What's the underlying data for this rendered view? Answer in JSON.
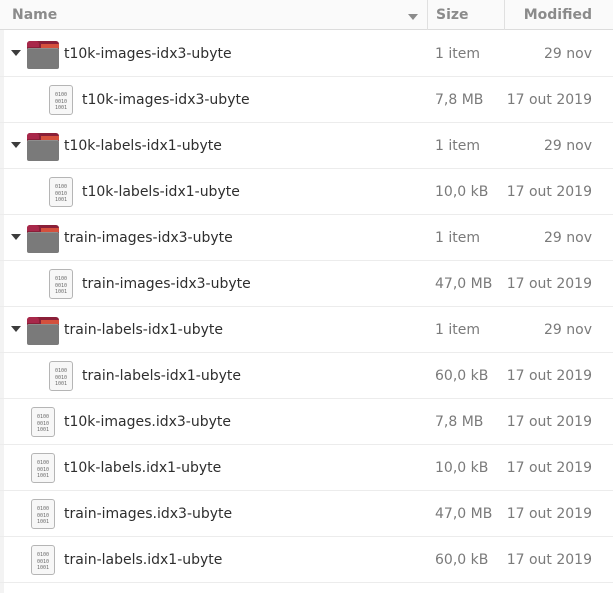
{
  "columns": {
    "name": "Name",
    "size": "Size",
    "modified": "Modified"
  },
  "rows": [
    {
      "type": "folder",
      "name": "t10k-images-idx3-ubyte",
      "size": "1 item",
      "modified": "29 nov"
    },
    {
      "type": "child-file",
      "name": "t10k-images-idx3-ubyte",
      "size": "7,8 MB",
      "modified": "17 out 2019"
    },
    {
      "type": "folder",
      "name": "t10k-labels-idx1-ubyte",
      "size": "1 item",
      "modified": "29 nov"
    },
    {
      "type": "child-file",
      "name": "t10k-labels-idx1-ubyte",
      "size": "10,0 kB",
      "modified": "17 out 2019"
    },
    {
      "type": "folder",
      "name": "train-images-idx3-ubyte",
      "size": "1 item",
      "modified": "29 nov"
    },
    {
      "type": "child-file",
      "name": "train-images-idx3-ubyte",
      "size": "47,0 MB",
      "modified": "17 out 2019"
    },
    {
      "type": "folder",
      "name": "train-labels-idx1-ubyte",
      "size": "1 item",
      "modified": "29 nov"
    },
    {
      "type": "child-file",
      "name": "train-labels-idx1-ubyte",
      "size": "60,0 kB",
      "modified": "17 out 2019"
    },
    {
      "type": "file",
      "name": "t10k-images.idx3-ubyte",
      "size": "7,8 MB",
      "modified": "17 out 2019"
    },
    {
      "type": "file",
      "name": "t10k-labels.idx1-ubyte",
      "size": "10,0 kB",
      "modified": "17 out 2019"
    },
    {
      "type": "file",
      "name": "train-images.idx3-ubyte",
      "size": "47,0 MB",
      "modified": "17 out 2019"
    },
    {
      "type": "file",
      "name": "train-labels.idx1-ubyte",
      "size": "60,0 kB",
      "modified": "17 out 2019"
    }
  ],
  "icons": {
    "folder": "folder-icon",
    "file": "binary-file-icon",
    "expander": "expander-arrow-icon",
    "sort": "sort-descending-icon"
  },
  "binary_glyph": [
    "0100",
    "0010",
    "1001"
  ]
}
